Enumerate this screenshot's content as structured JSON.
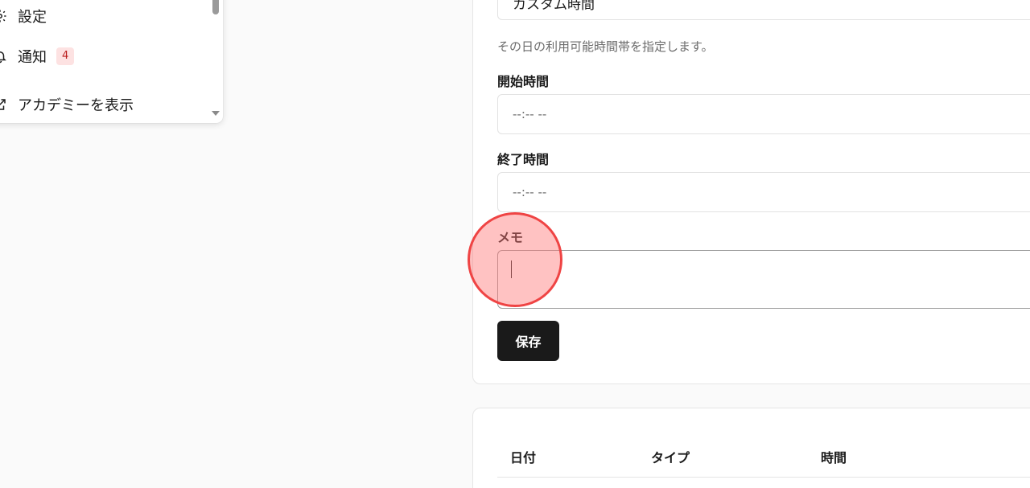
{
  "menu": {
    "items": [
      {
        "label": "設定",
        "icon": "gear-icon"
      },
      {
        "label": "通知",
        "icon": "bell-icon",
        "badge": "4"
      },
      {
        "label": "アカデミーを表示",
        "icon": "external-link-icon"
      }
    ]
  },
  "form": {
    "availability_type": "カスタム時間",
    "helper_text": "その日の利用可能時間帯を指定します。",
    "start_label": "開始時間",
    "start_placeholder": "--:-- --",
    "end_label": "終了時間",
    "end_placeholder": "--:-- --",
    "memo_label": "メモ",
    "memo_value": "",
    "save_label": "保存"
  },
  "table": {
    "headers": [
      "日付",
      "タイプ",
      "時間"
    ]
  },
  "colors": {
    "primary_button": "#1a1a1a",
    "badge_bg": "#fde2e2",
    "badge_text": "#b91c1c",
    "click_highlight": "#ef4444"
  }
}
